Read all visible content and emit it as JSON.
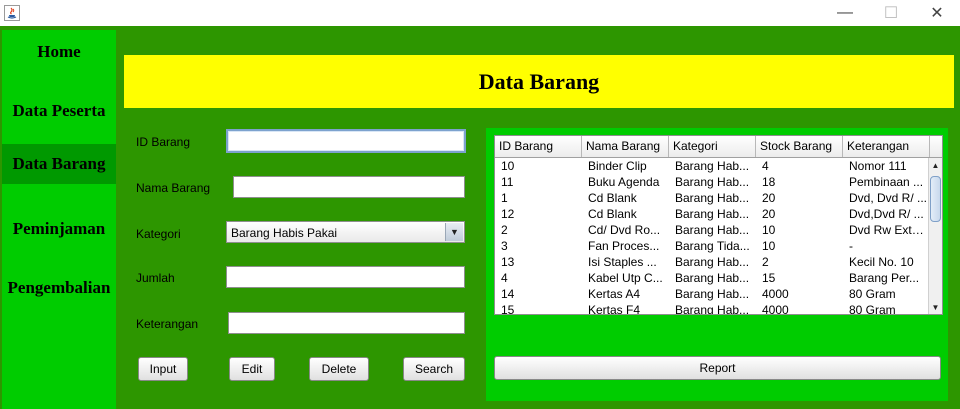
{
  "window": {
    "minimize_glyph": "—",
    "maximize_glyph": "☐",
    "close_glyph": "✕"
  },
  "sidebar": {
    "items": [
      {
        "label": "Home"
      },
      {
        "label": "Data Peserta"
      },
      {
        "label": "Data Barang",
        "active": true
      },
      {
        "label": "Peminjaman"
      },
      {
        "label": "Pengembalian"
      }
    ]
  },
  "header": {
    "title": "Data Barang"
  },
  "form": {
    "id_barang": {
      "label": "ID Barang",
      "value": ""
    },
    "nama_barang": {
      "label": "Nama Barang",
      "value": ""
    },
    "kategori": {
      "label": "Kategori",
      "selected": "Barang Habis Pakai"
    },
    "jumlah": {
      "label": "Jumlah",
      "value": ""
    },
    "keterangan": {
      "label": "Keterangan",
      "value": ""
    }
  },
  "buttons": {
    "input": "Input",
    "edit": "Edit",
    "delete": "Delete",
    "search": "Search",
    "report": "Report"
  },
  "table": {
    "columns": [
      "ID Barang",
      "Nama Barang",
      "Kategori",
      "Stock Barang",
      "Keterangan"
    ],
    "rows": [
      [
        "10",
        "Binder Clip",
        "Barang Hab...",
        "4",
        "Nomor 111"
      ],
      [
        "11",
        "Buku Agenda",
        "Barang Hab...",
        "18",
        "Pembinaan ..."
      ],
      [
        "1",
        "Cd Blank",
        "Barang Hab...",
        "20",
        "Dvd, Dvd R/ ..."
      ],
      [
        "12",
        "Cd Blank",
        "Barang Hab...",
        "20",
        "Dvd,Dvd R/ ..."
      ],
      [
        "2",
        "Cd/ Dvd Ro...",
        "Barang Hab...",
        "10",
        "Dvd Rw Exte..."
      ],
      [
        "3",
        "Fan Proces...",
        "Barang Tida...",
        "10",
        "-"
      ],
      [
        "13",
        "Isi Staples ...",
        "Barang Hab...",
        "2",
        "Kecil No. 10"
      ],
      [
        "4",
        "Kabel Utp C...",
        "Barang Hab...",
        "15",
        "Barang Per..."
      ],
      [
        "14",
        "Kertas A4",
        "Barang Hab...",
        "4000",
        "80 Gram"
      ],
      [
        "15",
        "Kertas F4",
        "Barang Hab...",
        "4000",
        "80 Gram"
      ]
    ]
  },
  "colors": {
    "frame": "#2d9600",
    "sidebar": "#00cc00",
    "sidebar_active": "#009900",
    "header": "#ffff00"
  }
}
